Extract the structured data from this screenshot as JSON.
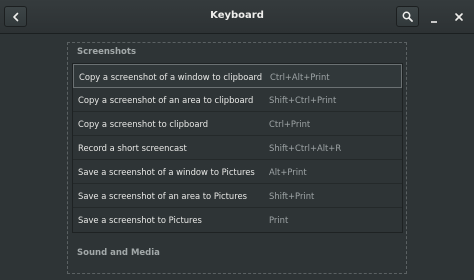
{
  "window": {
    "title": "Keyboard"
  },
  "icons": {
    "back": "chevron-left-icon",
    "search": "search-icon",
    "minimize": "minimize-icon",
    "close": "close-icon"
  },
  "sections": {
    "screenshots": {
      "header": "Screenshots",
      "items": [
        {
          "name": "Copy a screenshot of a window to clipboard",
          "accel": "Ctrl+Alt+Print"
        },
        {
          "name": "Copy a screenshot of an area to clipboard",
          "accel": "Shift+Ctrl+Print"
        },
        {
          "name": "Copy a screenshot to clipboard",
          "accel": "Ctrl+Print"
        },
        {
          "name": "Record a short screencast",
          "accel": "Shift+Ctrl+Alt+R"
        },
        {
          "name": "Save a screenshot of a window to Pictures",
          "accel": "Alt+Print"
        },
        {
          "name": "Save a screenshot of an area to Pictures",
          "accel": "Shift+Print"
        },
        {
          "name": "Save a screenshot to Pictures",
          "accel": "Print"
        }
      ]
    },
    "sound_media": {
      "header": "Sound and Media"
    }
  },
  "colors": {
    "background": "#2e3436",
    "text": "#eeeeec",
    "accelerator_text": "#9ea4a6",
    "section_header": "#a2a8a9"
  }
}
